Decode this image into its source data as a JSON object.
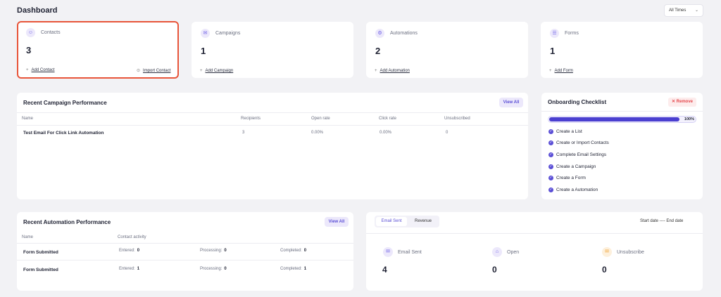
{
  "header": {
    "title": "Dashboard",
    "time_filter": "All Times"
  },
  "stats": [
    {
      "label": "Contacts",
      "value": "3",
      "links": [
        "Add Contact",
        "Import Contact"
      ]
    },
    {
      "label": "Campaigns",
      "value": "1",
      "links": [
        "Add Campaign"
      ]
    },
    {
      "label": "Automations",
      "value": "2",
      "links": [
        "Add Automation"
      ]
    },
    {
      "label": "Forms",
      "value": "1",
      "links": [
        "Add Form"
      ]
    }
  ],
  "campaign_performance": {
    "title": "Recent Campaign Performance",
    "view_all": "View All",
    "columns": [
      "Name",
      "Recipients",
      "Open rate",
      "Click rate",
      "Unsubscribed"
    ],
    "rows": [
      {
        "name": "Test Email For Click Link Automation",
        "recipients": "3",
        "open_rate": "0.00%",
        "click_rate": "0.00%",
        "unsubscribed": "0"
      }
    ]
  },
  "onboarding": {
    "title": "Onboarding Checklist",
    "remove": "Remove",
    "progress_label": "100%",
    "progress": 1.0,
    "items": [
      "Create a List",
      "Create or Import Contacts",
      "Complete Email Settings",
      "Create a Campaign",
      "Create a Form",
      "Create a Automation"
    ]
  },
  "automation_performance": {
    "title": "Recent Automation Performance",
    "view_all": "View All",
    "columns": [
      "Name",
      "Contact activity"
    ],
    "rows": [
      {
        "name": "Form Submitted",
        "entered_label": "Entered:",
        "entered": "0",
        "processing_label": "Processing:",
        "processing": "0",
        "completed_label": "Completed:",
        "completed": "0"
      },
      {
        "name": "Form Submitted",
        "entered_label": "Entered:",
        "entered": "1",
        "processing_label": "Processing:",
        "processing": "0",
        "completed_label": "Completed:",
        "completed": "1"
      }
    ]
  },
  "email_stats": {
    "tabs": [
      "Email Sent",
      "Revenue"
    ],
    "active_tab": "Email Sent",
    "date_range": "Start date ---- End date",
    "metrics": [
      {
        "label": "Email Sent",
        "value": "4",
        "color": "#6d5fe6"
      },
      {
        "label": "Open",
        "value": "0",
        "color": "#6d5fe6"
      },
      {
        "label": "Unsubscribe",
        "value": "0",
        "color": "#f0a030"
      }
    ]
  },
  "colors": {
    "accent": "#5b4fd6",
    "highlight_border": "#e8553a",
    "remove": "#e5484d"
  }
}
